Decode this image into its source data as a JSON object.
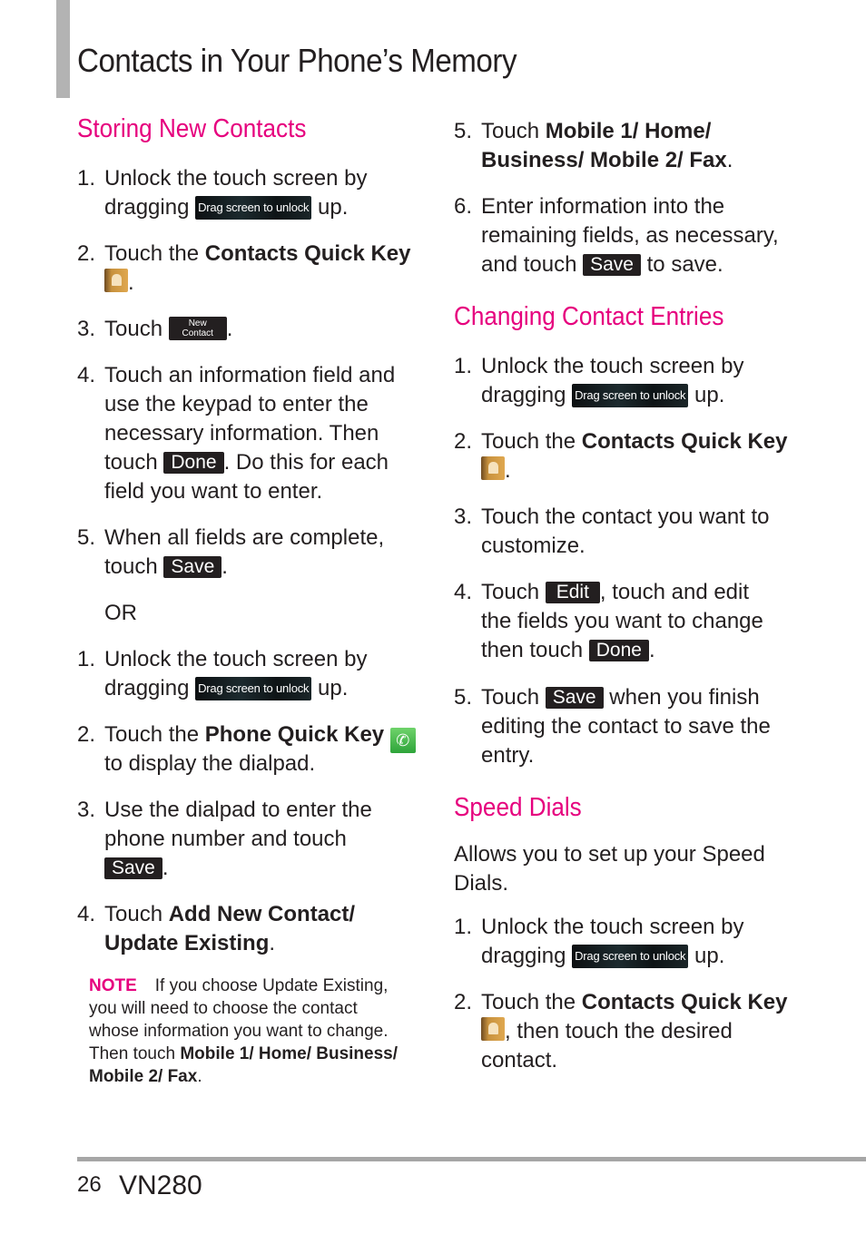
{
  "page": {
    "title": "Contacts in Your Phone’s Memory",
    "page_number": "26",
    "model": "VN280"
  },
  "chips": {
    "unlock": "Drag screen to unlock",
    "new_contact_line1": "New",
    "new_contact_line2": "Contact",
    "done": "Done",
    "save": "Save",
    "edit": "Edit"
  },
  "storing": {
    "title": "Storing New Contacts",
    "s1_num": "1.",
    "s1_l1": "Unlock the touch screen by",
    "s1_l2a": "dragging",
    "s1_l2b": "up.",
    "s2_num": "2.",
    "s2_l1a": "Touch the ",
    "s2_l1b": "Contacts Quick Key",
    "s2_l2b": ".",
    "s3_num": "3.",
    "s3_l1a": "Touch",
    "s3_l1b": ".",
    "s4_num": "4.",
    "s4_l1": "Touch an information field and",
    "s4_l2": "use the keypad to enter the",
    "s4_l3": "necessary information. Then",
    "s4_l4a": "touch",
    "s4_l4b": ". Do this for each",
    "s4_l5": "field you want to enter.",
    "s5_num": "5.",
    "s5_l1": "When all fields are complete,",
    "s5_l2a": "touch",
    "s5_l2b": ".",
    "or": "OR",
    "t1_num": "1.",
    "t1_l1": "Unlock the touch screen by",
    "t1_l2a": "dragging",
    "t1_l2b": "up.",
    "t2_num": "2.",
    "t2_l1a": "Touch the ",
    "t2_l1b": "Phone Quick Key",
    "t2_l2": "to display the dialpad.",
    "t3_num": "3.",
    "t3_l1": "Use the dialpad to enter the",
    "t3_l2": "phone number and touch",
    "t3_l3b": ".",
    "t4_num": "4.",
    "t4_l1a": "Touch ",
    "t4_l1b": "Add New Contact/",
    "t4_l2a": "Update Existing",
    "t4_l2b": ".",
    "note_label": "NOTE",
    "note_l1": "If you choose Update Existing,",
    "note_l2": "you will need to choose the contact",
    "note_l3": "whose information you want to change.",
    "note_l4a": "Then touch ",
    "note_l4b": "Mobile 1/ Home/ Business/",
    "note_l5a": "Mobile 2/ Fax",
    "note_l5b": "."
  },
  "storing_cont": {
    "s5_num": "5.",
    "s5_l1a": "Touch ",
    "s5_l1b": "Mobile 1/ Home/",
    "s5_l2a": "Business/ Mobile 2/ Fax",
    "s5_l2b": ".",
    "s6_num": "6.",
    "s6_l1": "Enter information into the",
    "s6_l2": "remaining fields, as necessary,",
    "s6_l3a": "and touch",
    "s6_l3b": "to save."
  },
  "changing": {
    "title": "Changing Contact Entries",
    "s1_num": "1.",
    "s1_l1": "Unlock the touch screen by",
    "s1_l2a": "dragging",
    "s1_l2b": "up.",
    "s2_num": "2.",
    "s2_l1a": "Touch the ",
    "s2_l1b": "Contacts Quick Key",
    "s2_l2b": ".",
    "s3_num": "3.",
    "s3_l1": "Touch the contact you want to",
    "s3_l2": "customize.",
    "s4_num": "4.",
    "s4_l1a": "Touch",
    "s4_l1b": ", touch and edit",
    "s4_l2": "the fields you want to change",
    "s4_l3a": "then touch",
    "s4_l3b": ".",
    "s5_num": "5.",
    "s5_l1a": "Touch",
    "s5_l1b": "when you finish",
    "s5_l2": "editing the contact to save the",
    "s5_l3": "entry."
  },
  "speed": {
    "title": "Speed Dials",
    "intro_l1": "Allows you to set up your Speed",
    "intro_l2": "Dials.",
    "s1_num": "1.",
    "s1_l1": "Unlock the touch screen by",
    "s1_l2a": "dragging",
    "s1_l2b": "up.",
    "s2_num": "2.",
    "s2_l1a": "Touch the ",
    "s2_l1b": "Contacts Quick Key",
    "s2_l2b": ", then touch the desired",
    "s2_l3": "contact."
  },
  "icons": {
    "phone_glyph": "✆"
  }
}
